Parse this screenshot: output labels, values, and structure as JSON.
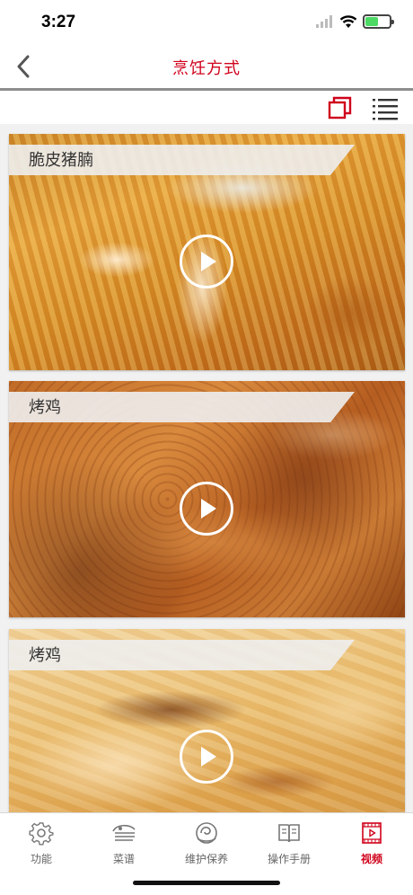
{
  "status_bar": {
    "time": "3:27",
    "battery_level": 0.55,
    "battery_color": "#4cd964"
  },
  "nav": {
    "title": "烹饪方式",
    "back_icon": "chevron-left-icon",
    "accent_color": "#d0021b"
  },
  "view_toggle": {
    "grid_icon": "grid-view-icon",
    "list_icon": "list-view-icon"
  },
  "videos": [
    {
      "title": "脆皮猪腩",
      "thumbnail": "crispy-pork-belly",
      "play_icon": "play-icon"
    },
    {
      "title": "烤鸡",
      "thumbnail": "roast-chicken",
      "play_icon": "play-icon"
    },
    {
      "title": "烤鸡",
      "thumbnail": "roast-chicken",
      "play_icon": "play-icon"
    }
  ],
  "tabs": [
    {
      "label": "功能",
      "icon": "gear-icon",
      "active": false
    },
    {
      "label": "菜谱",
      "icon": "recipe-icon",
      "active": false
    },
    {
      "label": "维护保养",
      "icon": "maintenance-icon",
      "active": false
    },
    {
      "label": "操作手册",
      "icon": "book-icon",
      "active": false
    },
    {
      "label": "视频",
      "icon": "video-icon",
      "active": true
    }
  ]
}
